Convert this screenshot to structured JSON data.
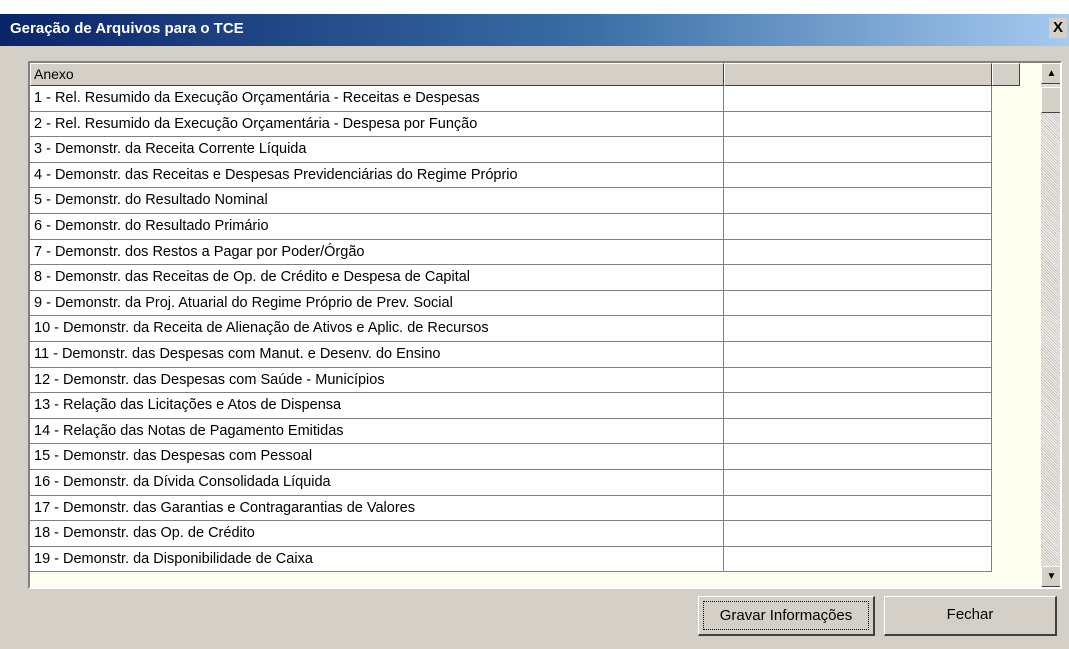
{
  "window": {
    "title": "Geração de Arquivos para o TCE",
    "close_label": "X"
  },
  "grid": {
    "columns": [
      "Anexo",
      ""
    ],
    "rows": [
      "1 - Rel. Resumido da Execução Orçamentária - Receitas e Despesas",
      "2 - Rel. Resumido da Execução Orçamentária - Despesa por Função",
      "3 - Demonstr. da Receita Corrente Líquida",
      "4 - Demonstr. das Receitas e Despesas Previdenciárias do Regime Próprio",
      "5 - Demonstr. do Resultado Nominal",
      "6 - Demonstr. do Resultado Primário",
      "7 - Demonstr. dos Restos a Pagar por Poder/Órgão",
      "8 - Demonstr. das Receitas de Op. de Crédito e Despesa de Capital",
      "9 - Demonstr. da Proj. Atuarial do Regime Próprio de Prev. Social",
      "10 - Demonstr. da Receita de Alienação de Ativos e Aplic. de Recursos",
      "11 - Demonstr. das Despesas com Manut. e Desenv. do Ensino",
      "12 - Demonstr. das Despesas com Saúde - Municípios",
      "13 - Relação das Licitações e Atos de Dispensa",
      "14 - Relação das Notas de Pagamento Emitidas",
      "15 - Demonstr. das Despesas com Pessoal",
      "16 - Demonstr. da Dívida Consolidada Líquida",
      "17 - Demonstr. das Garantias e Contragarantias de Valores",
      "18 - Demonstr. das Op. de Crédito",
      "19 - Demonstr. da Disponibilidade de Caixa"
    ]
  },
  "scrollbar": {
    "up_icon": "scroll-up-arrow",
    "down_icon": "scroll-down-arrow"
  },
  "buttons": {
    "save_label": "Gravar Informações",
    "close_label": "Fechar"
  },
  "colors": {
    "title_gradient_start": "#0a246a",
    "title_gradient_end": "#a6caf0",
    "window_face": "#d4d0c8",
    "grid_empty_area": "#fffff0"
  }
}
